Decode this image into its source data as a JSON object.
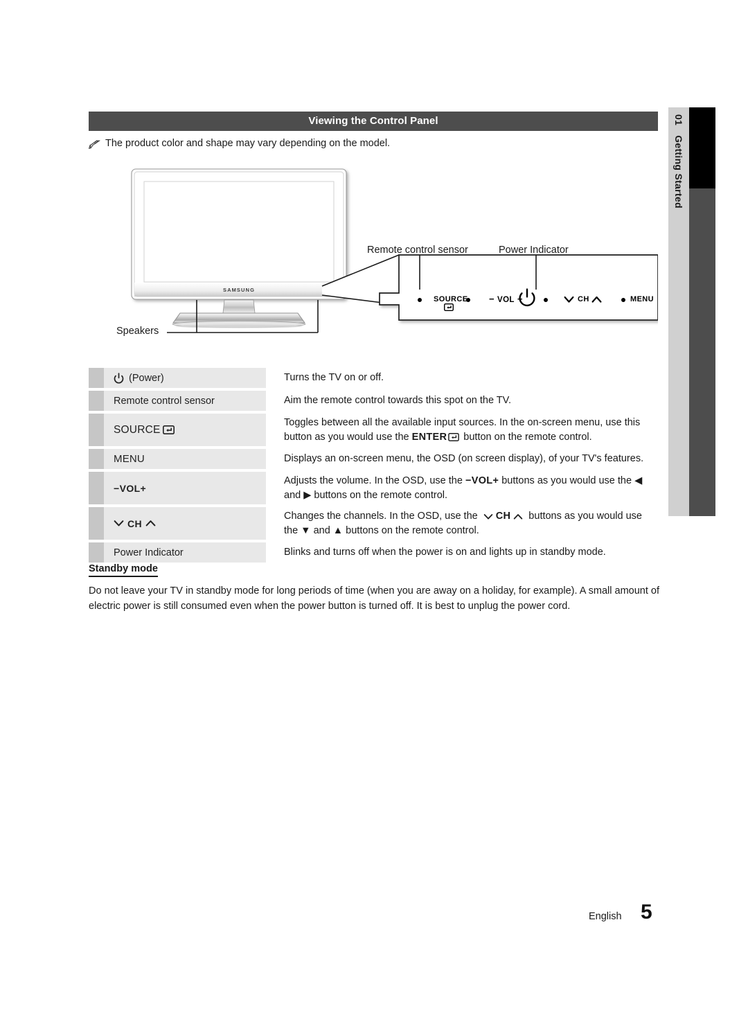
{
  "sidebar": {
    "chapter_number": "01",
    "chapter_title": "Getting Started"
  },
  "section": {
    "title": "Viewing the Control Panel",
    "note": "The product color and shape may vary depending on the model.",
    "note_icon": "pencil-note-icon"
  },
  "figure": {
    "brand_logo": "SAMSUNG",
    "labels": {
      "speakers": "Speakers",
      "remote_control_sensor": "Remote control sensor",
      "power_indicator": "Power Indicator"
    },
    "panel": {
      "source": "SOURCE",
      "source_icon": "enter-return-icon",
      "vol_minus": "−",
      "vol": "VOL",
      "vol_plus": "+",
      "power_icon": "power-icon",
      "ch_down_icon": "chevron-down-icon",
      "ch": "CH",
      "ch_up_icon": "chevron-up-icon",
      "menu": "MENU"
    }
  },
  "table": {
    "rows": [
      {
        "label_icon": "power-icon",
        "label": "(Power)",
        "label_style": "power",
        "desc": "Turns the TV on or off.",
        "tall": false
      },
      {
        "label": "Remote control sensor",
        "label_style": "plain",
        "desc": "Aim the remote control towards this spot on the TV.",
        "tall": false
      },
      {
        "label": "SOURCE",
        "label_icon": "enter-return-icon",
        "label_style": "source",
        "desc_part1": "Toggles between all the available input sources. In the on-screen menu, use this button as you would use the ",
        "desc_inline": "ENTER",
        "desc_inline_icon": "enter-return-icon",
        "desc_part2": " button on the remote control.",
        "tall": true
      },
      {
        "label": "MENU",
        "label_style": "menu",
        "desc": "Displays an on-screen menu, the OSD (on screen display), of your TV's features.",
        "tall": false
      },
      {
        "label": "−VOL+",
        "label_style": "vol",
        "desc_part1": "Adjusts the volume. In the OSD, use the ",
        "desc_inline": "−VOL+",
        "desc_part2": " buttons as you would use the ◀ and ▶ buttons on the remote control.",
        "tall": true
      },
      {
        "label": "CH",
        "label_style": "ch",
        "desc_part1": "Changes the channels. In the OSD, use the ",
        "desc_inline": "CH",
        "desc_part2": " buttons as you would use the ▼ and ▲ buttons on the remote control.",
        "tall": true
      },
      {
        "label": "Power Indicator",
        "label_style": "plain",
        "desc": "Blinks and turns off when the power is on and lights up in standby mode.",
        "tall": false
      }
    ]
  },
  "standby": {
    "heading": "Standby mode",
    "body": "Do not leave your TV in standby mode for long periods of time (when you are away on a holiday, for example). A small amount of electric power is still consumed even when the power button is turned off. It is best to unplug the power cord."
  },
  "footer": {
    "language": "English",
    "page_number": "5"
  },
  "colors": {
    "title_bar": "#4d4d4d",
    "tab_bg": "#d0d0d0",
    "row_gutter": "#c6c6c6",
    "row_label": "#e8e8e8"
  }
}
